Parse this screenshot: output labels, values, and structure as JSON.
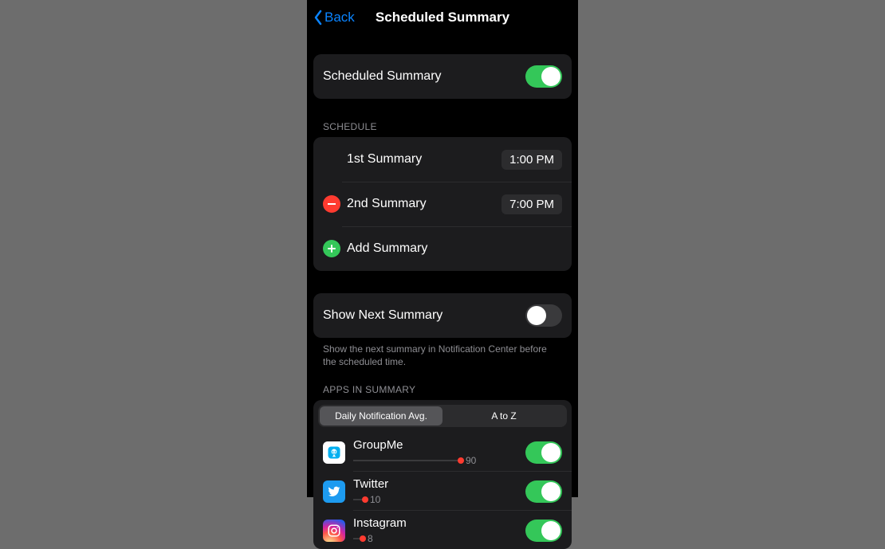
{
  "nav": {
    "back": "Back",
    "title": "Scheduled Summary"
  },
  "main_toggle": {
    "label": "Scheduled Summary",
    "on": true
  },
  "schedule": {
    "header": "SCHEDULE",
    "items": [
      {
        "label": "1st Summary",
        "time": "1:00 PM",
        "icon": "none"
      },
      {
        "label": "2nd Summary",
        "time": "7:00 PM",
        "icon": "minus"
      }
    ],
    "add_label": "Add Summary"
  },
  "show_next": {
    "label": "Show Next Summary",
    "on": false,
    "footer": "Show the next summary in Notification Center before the scheduled time."
  },
  "apps": {
    "header": "APPS IN SUMMARY",
    "segments": [
      "Daily Notification Avg.",
      "A to Z"
    ],
    "selected_segment": 0,
    "max_avg": 100,
    "items": [
      {
        "name": "GroupMe",
        "avg": 90,
        "icon": "groupme",
        "on": true
      },
      {
        "name": "Twitter",
        "avg": 10,
        "icon": "twitter",
        "on": true
      },
      {
        "name": "Instagram",
        "avg": 8,
        "icon": "instagram",
        "on": true
      }
    ]
  },
  "colors": {
    "accent_blue": "#0a84ff",
    "toggle_green": "#34c759",
    "delete_red": "#ff3b30"
  }
}
